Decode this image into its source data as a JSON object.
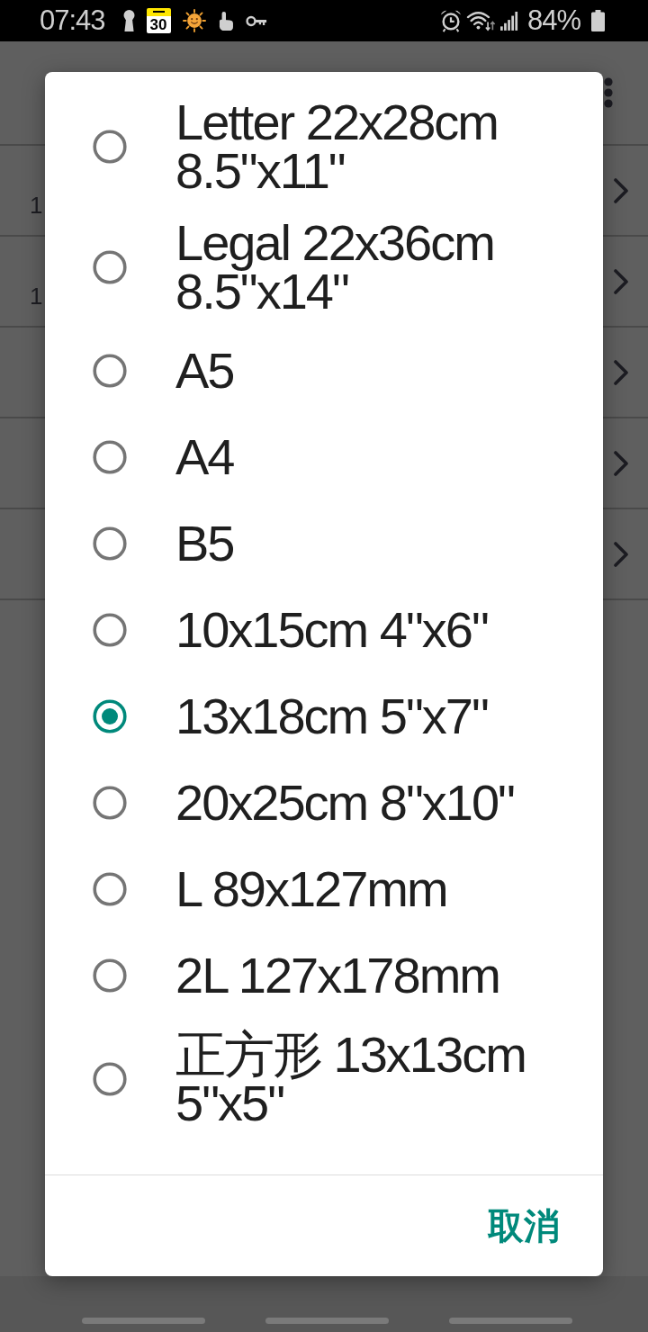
{
  "status_bar": {
    "time": "07:43",
    "calendar_day": "30",
    "battery": "84%"
  },
  "background_screen": {
    "rows": [
      {
        "subtitle": "1",
        "chevron": true
      },
      {
        "subtitle": "1",
        "chevron": true
      },
      {
        "chevron": true
      },
      {
        "chevron": true
      },
      {
        "chevron": true
      }
    ]
  },
  "dialog": {
    "options": [
      {
        "label": "Letter 22x28cm 8.5\"x11\"",
        "selected": false
      },
      {
        "label": "Legal 22x36cm 8.5\"x14\"",
        "selected": false
      },
      {
        "label": "A5",
        "selected": false
      },
      {
        "label": "A4",
        "selected": false
      },
      {
        "label": "B5",
        "selected": false
      },
      {
        "label": "10x15cm 4\"x6\"",
        "selected": false
      },
      {
        "label": "13x18cm 5\"x7\"",
        "selected": true
      },
      {
        "label": "20x25cm 8\"x10\"",
        "selected": false
      },
      {
        "label": "L 89x127mm",
        "selected": false
      },
      {
        "label": "2L 127x178mm",
        "selected": false
      },
      {
        "label": "正方形 13x13cm 5\"x5\"",
        "selected": false
      }
    ],
    "cancel_button": "取消"
  }
}
